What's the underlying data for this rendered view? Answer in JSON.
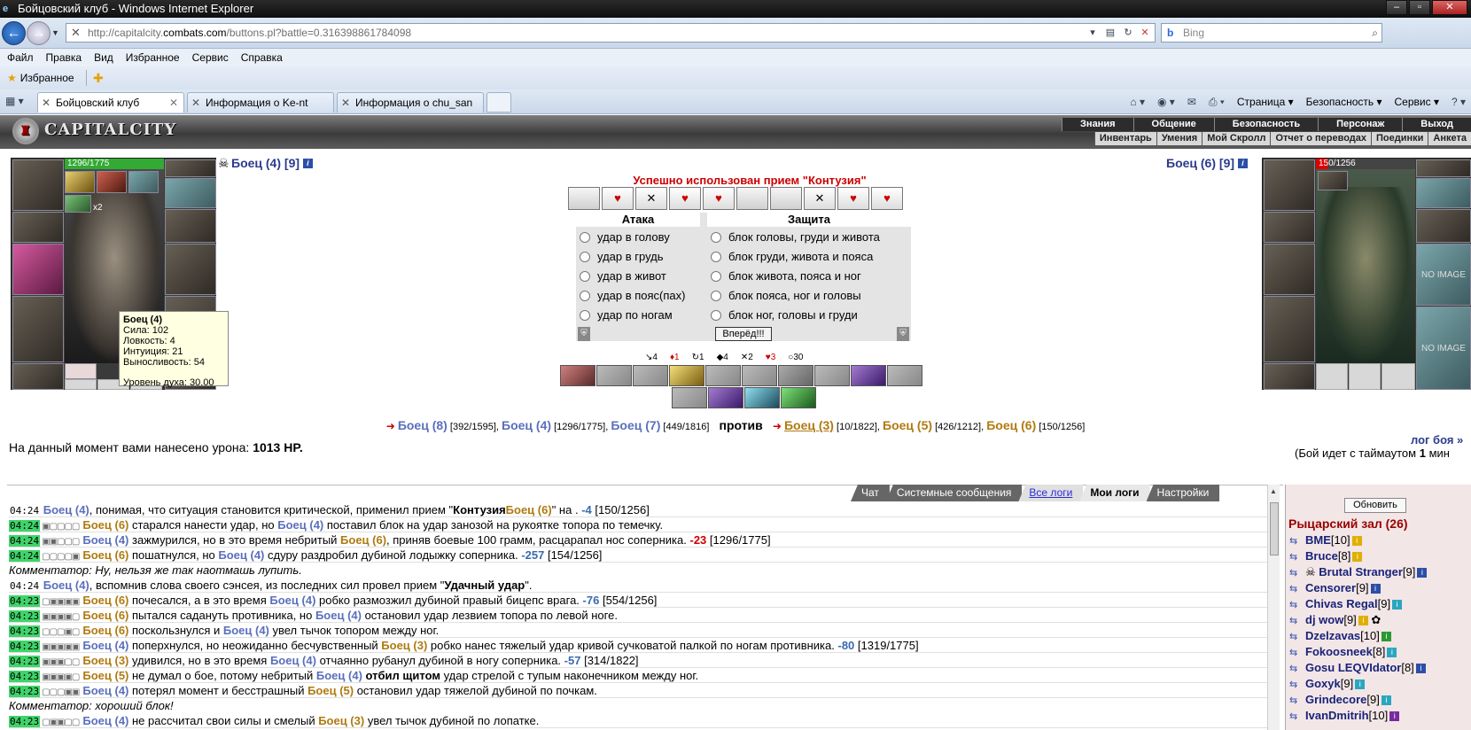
{
  "browser": {
    "window_title": "Бойцовский клуб - Windows Internet Explorer",
    "url_prefix": "http://capitalcity.",
    "url_domain": "combats.com",
    "url_path": "/buttons.pl?battle=0.316398861784098",
    "search_placeholder": "Bing",
    "menu": [
      "Файл",
      "Правка",
      "Вид",
      "Избранное",
      "Сервис",
      "Справка"
    ],
    "favorites_label": "Избранное",
    "tabs": [
      {
        "label": "Бойцовский клуб",
        "active": true
      },
      {
        "label": "Информация о Ke-nt",
        "active": false
      },
      {
        "label": "Информация о chu_san",
        "active": false
      }
    ],
    "command_bar": {
      "page": "Страница",
      "safety": "Безопасность",
      "service": "Сервис"
    }
  },
  "game_header": {
    "logo": "CAPITALCITY",
    "nav_top": [
      "Знания",
      "Общение",
      "Безопасность",
      "Персонаж",
      "Выход"
    ],
    "nav_bottom": [
      "Инвентарь",
      "Умения",
      "Мой Скролл",
      "Отчет о переводах",
      "Поединки",
      "Анкета"
    ]
  },
  "left_fighter": {
    "hp_text": "1296/1775",
    "hp_fraction": 0.73,
    "name": "Боец (4)",
    "level": "[9]",
    "multiplier": "x2",
    "tooltip": {
      "name": "Боец (4)",
      "lines": [
        "Сила: 102",
        "Ловкость: 4",
        "Интуиция: 21",
        "Выносливость: 54"
      ],
      "spirit": "Уровень духа: 30.00"
    }
  },
  "right_fighter": {
    "hp_text": "150/1256",
    "hp_fraction": 0.12,
    "name": "Боец (6)",
    "level": "[9]",
    "no_image": "NO IMAGE"
  },
  "battle": {
    "success_message": "Успешно использован прием \"Контузия\"",
    "attack_header": "Атака",
    "defense_header": "Защита",
    "attacks": [
      "удар в голову",
      "удар в грудь",
      "удар в живот",
      "удар в пояс(пах)",
      "удар по ногам"
    ],
    "defenses": [
      "блок головы, груди и живота",
      "блок груди, живота и пояса",
      "блок живота, пояса и ног",
      "блок пояса, ног и головы",
      "блок ног, головы и груди"
    ],
    "submit_label": "Вперёд!!!",
    "counters": [
      "↘4",
      "♦1",
      "↻1",
      "◆4",
      "✕2",
      "♥3",
      "○30"
    ]
  },
  "teams": {
    "left": [
      {
        "name": "Боец (8)",
        "hp": "[392/1595]"
      },
      {
        "name": "Боец (4)",
        "hp": "[1296/1775]"
      },
      {
        "name": "Боец (7)",
        "hp": "[449/1816]"
      }
    ],
    "versus": "против",
    "right": [
      {
        "name": "Боец (3)",
        "hp": "[10/1822]"
      },
      {
        "name": "Боец (5)",
        "hp": "[426/1212]"
      },
      {
        "name": "Боец (6)",
        "hp": "[150/1256]"
      }
    ]
  },
  "damage": {
    "prefix": "На данный момент вами нанесено урона:",
    "value": "1013 HP."
  },
  "fight_log_link": "лог боя »",
  "timeout": {
    "prefix": "(Бой идет с таймаутом",
    "value": "1",
    "suffix": "мин"
  },
  "log_tabs": [
    "Чат",
    "Системные сообщения",
    "Все логи",
    "Мои логи",
    "Настройки"
  ],
  "log": [
    {
      "time": "04:24",
      "plain": true,
      "a": "Боец (4)",
      "a_team": "blue",
      "t1": ", понимая, что ситуация становится критической, применил прием \"",
      "bold": "Контузия",
      "t2": "\" на ",
      "b": "Боец (6)",
      "b_team": "gold",
      "t3": ".",
      "dmg": "-4",
      "dmg_color": "blue",
      "hp": "[150/1256]"
    },
    {
      "time": "04:24",
      "blocks": "▣▢▢▢▢",
      "a": "Боец (6)",
      "a_team": "gold",
      "t1": " старался нанести удар, но ",
      "b": "Боец (4)",
      "b_team": "blue",
      "t2": " поставил блок на удар занозой на рукоятке топора по темечку."
    },
    {
      "time": "04:24",
      "blocks": "▣▣▢▢▢",
      "a": "Боец (4)",
      "a_team": "blue",
      "t1": " зажмурился, но в это время небритый ",
      "b": "Боец (6)",
      "b_team": "gold",
      "t2": ", приняв боевые 100 грамм, расцарапал нос соперника.",
      "dmg": "-23",
      "dmg_color": "red",
      "hp": "[1296/1775]"
    },
    {
      "time": "04:24",
      "blocks": "▢▢▢▢▣",
      "a": "Боец (6)",
      "a_team": "gold",
      "t1": " пошатнулся, но ",
      "b": "Боец (4)",
      "b_team": "blue",
      "t2": " сдуру раздробил дубиной лодыжку соперника.",
      "dmg": "-257",
      "dmg_color": "blue",
      "hp": "[154/1256]"
    },
    {
      "comment": "Комментатор: Ну, нельзя же так наотмашь лупить."
    },
    {
      "time": "04:24",
      "plain": true,
      "a": "Боец (4)",
      "a_team": "blue",
      "t1": ", вспомнив слова своего сэнсея, из последних сил провел прием \"",
      "bold": "Удачный удар",
      "t2": "\"."
    },
    {
      "time": "04:23",
      "blocks": "▢▣▣▣▣",
      "a": "Боец (6)",
      "a_team": "gold",
      "t1": " почесался, а в это время ",
      "b": "Боец (4)",
      "b_team": "blue",
      "t2": " робко размозжил дубиной правый бицепс врага.",
      "dmg": "-76",
      "dmg_color": "blue",
      "hp": "[554/1256]"
    },
    {
      "time": "04:23",
      "blocks": "▣▣▣▣▢",
      "a": "Боец (6)",
      "a_team": "gold",
      "t1": " пытался садануть противника, но ",
      "b": "Боец (4)",
      "b_team": "blue",
      "t2": " остановил удар лезвием топора по левой ноге."
    },
    {
      "time": "04:23",
      "blocks": "▢▢▢▣▢",
      "a": "Боец (6)",
      "a_team": "gold",
      "t1": " поскользнулся и ",
      "b": "Боец (4)",
      "b_team": "blue",
      "t2": " увел тычок топором между ног."
    },
    {
      "time": "04:23",
      "blocks": "▣▣▣▣▣",
      "a": "Боец (4)",
      "a_team": "blue",
      "t1": " поперхнулся, но неожиданно бесчувственный ",
      "b": "Боец (3)",
      "b_team": "gold",
      "t2": " робко нанес тяжелый удар кривой сучковатой палкой по ногам противника.",
      "dmg": "-80",
      "dmg_color": "blue",
      "hp": "[1319/1775]"
    },
    {
      "time": "04:23",
      "blocks": "▣▣▣▢▢",
      "a": "Боец (3)",
      "a_team": "gold",
      "t1": " удивился, но в это время ",
      "b": "Боец (4)",
      "b_team": "blue",
      "t2": " отчаянно рубанул дубиной в ногу соперника.",
      "dmg": "-57",
      "dmg_color": "blue",
      "hp": "[314/1822]"
    },
    {
      "time": "04:23",
      "blocks": "▣▣▣▣▢",
      "a": "Боец (5)",
      "a_team": "gold",
      "t1": " не думал о бое, потому небритый ",
      "b": "Боец (4)",
      "b_team": "blue",
      "bold2": "отбил щитом",
      "t2": " удар стрелой с тупым наконечником между ног."
    },
    {
      "time": "04:23",
      "blocks": "▢▢▢▣▣",
      "a": "Боец (4)",
      "a_team": "blue",
      "t1": " потерял момент и бесстрашный ",
      "b": "Боец (5)",
      "b_team": "gold",
      "t2": " остановил удар тяжелой дубиной по почкам."
    },
    {
      "comment": "Комментатор: хороший блок!"
    },
    {
      "time": "04:23",
      "blocks": "▢▣▣▢▢",
      "a": "Боец (4)",
      "a_team": "blue",
      "t1": " не рассчитал свои силы и смелый ",
      "b": "Боец (3)",
      "b_team": "gold",
      "t2": " увел тычок дубиной по лопатке."
    }
  ],
  "room": {
    "refresh_label": "Обновить",
    "title": "Рыцарский зал (26)",
    "players": [
      {
        "nick": "BME",
        "level": "[10]",
        "badge": "gold"
      },
      {
        "nick": "Bruce",
        "level": "[8]",
        "badge": "gold"
      },
      {
        "nick": "Brutal Stranger",
        "level": "[9]",
        "badge": "blue",
        "clan": "☠"
      },
      {
        "nick": "Censorer",
        "level": "[9]",
        "badge": "blue"
      },
      {
        "nick": "Chivas Regal",
        "level": "[9]",
        "badge": "cyan"
      },
      {
        "nick": "dj wow",
        "level": "[9]",
        "badge": "gold",
        "extra": "✿"
      },
      {
        "nick": "Dzelzavas",
        "level": "[10]",
        "badge": "green"
      },
      {
        "nick": "Fokoosneek",
        "level": "[8]",
        "badge": "cyan"
      },
      {
        "nick": "Gosu LEQVIdator",
        "level": "[8]",
        "badge": "blue"
      },
      {
        "nick": "Goxyk",
        "level": "[9]",
        "badge": "cyan"
      },
      {
        "nick": "Grindecore",
        "level": "[9]",
        "badge": "cyan"
      },
      {
        "nick": "IvanDmitrih",
        "level": "[10]",
        "badge": "purple"
      }
    ]
  }
}
